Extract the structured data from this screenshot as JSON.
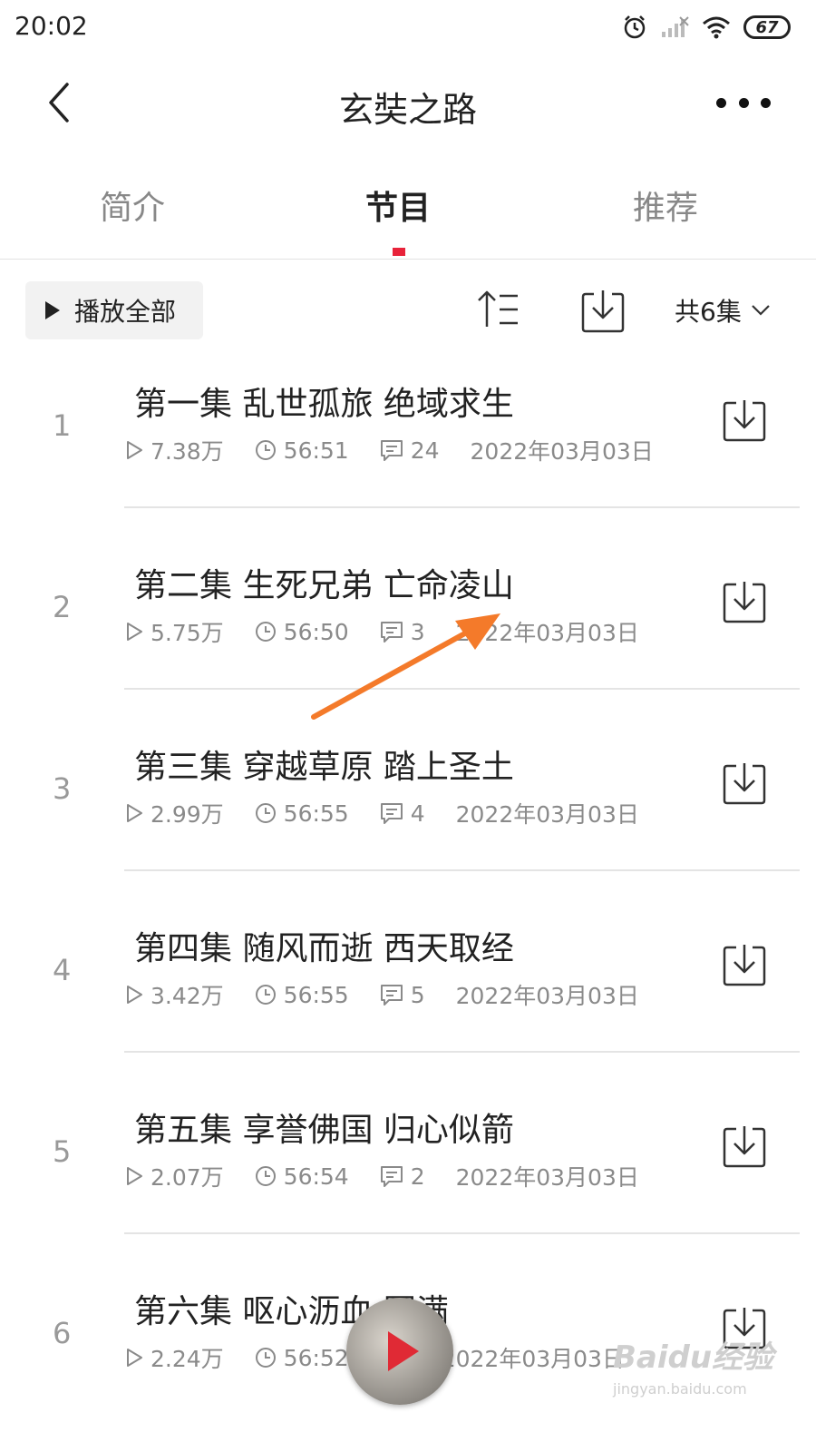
{
  "status_bar": {
    "time": "20:02",
    "battery": "67",
    "icons": [
      "alarm-icon",
      "signal-icon",
      "wifi-icon",
      "battery-icon"
    ]
  },
  "header": {
    "title": "玄奘之路",
    "back_icon": "chevron-left-icon",
    "more_icon": "more-horizontal-icon"
  },
  "tabs": [
    {
      "label": "简介",
      "active": false
    },
    {
      "label": "节目",
      "active": true
    },
    {
      "label": "推荐",
      "active": false
    }
  ],
  "accent_color": "#e8233a",
  "toolbar": {
    "play_all_label": "播放全部",
    "count_label": "共6集",
    "sort_icon": "sort-icon",
    "download_icon": "download-icon"
  },
  "episodes": [
    {
      "num": "1",
      "title": "第一集 乱世孤旅 绝域求生",
      "plays": "7.38万",
      "duration": "56:51",
      "comments": "24",
      "date": "2022年03月03日"
    },
    {
      "num": "2",
      "title": "第二集 生死兄弟 亡命凌山",
      "plays": "5.75万",
      "duration": "56:50",
      "comments": "3",
      "date": "2022年03月03日"
    },
    {
      "num": "3",
      "title": "第三集 穿越草原 踏上圣土",
      "plays": "2.99万",
      "duration": "56:55",
      "comments": "4",
      "date": "2022年03月03日"
    },
    {
      "num": "4",
      "title": "第四集 随风而逝 西天取经",
      "plays": "3.42万",
      "duration": "56:55",
      "comments": "5",
      "date": "2022年03月03日"
    },
    {
      "num": "5",
      "title": "第五集 享誉佛国 归心似箭",
      "plays": "2.07万",
      "duration": "56:54",
      "comments": "2",
      "date": "2022年03月03日"
    },
    {
      "num": "6",
      "title": "第六集 呕心沥血 圆满",
      "plays": "2.24万",
      "duration": "56:52",
      "comments": "",
      "date": "2022年03月03日"
    }
  ],
  "overlay": {
    "arrow_color": "#f47a2a",
    "watermark_main": "Baidu经验",
    "watermark_sub": "jingyan.baidu.com"
  }
}
